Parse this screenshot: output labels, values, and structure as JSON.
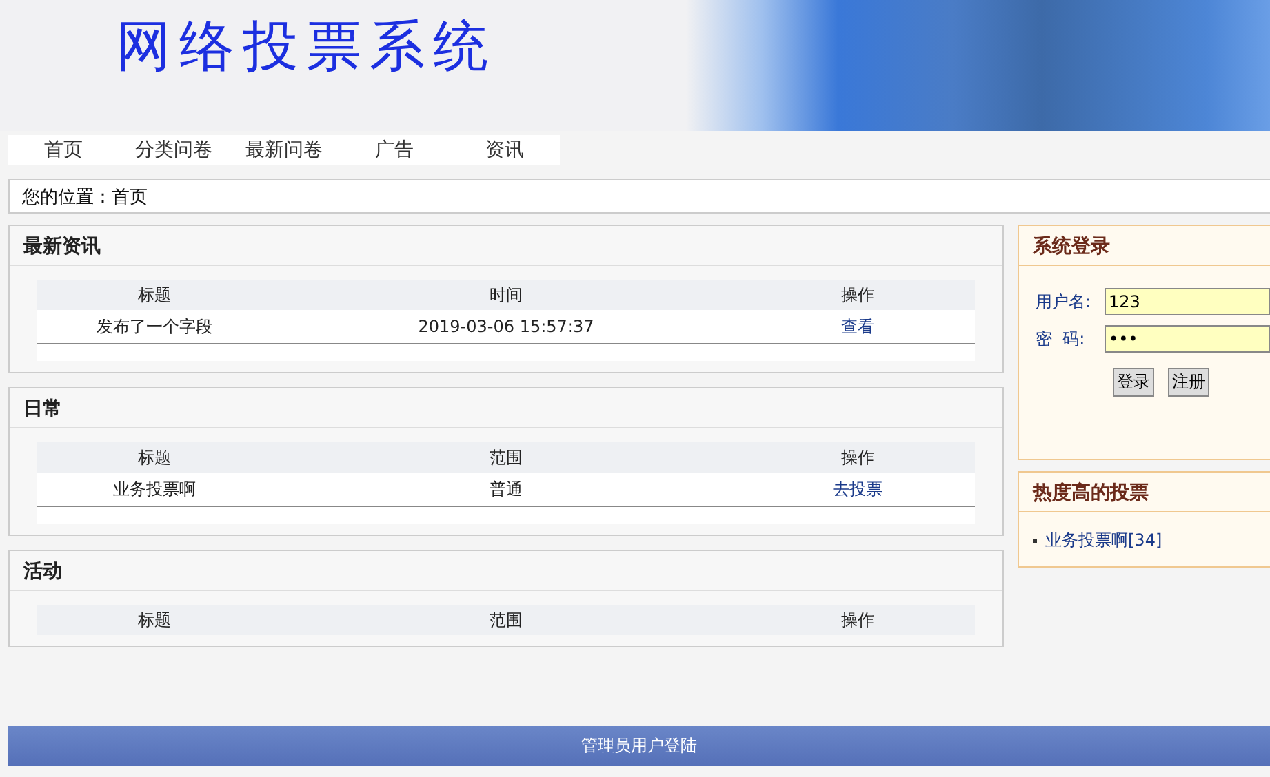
{
  "header": {
    "title": "网络投票系统"
  },
  "nav": [
    {
      "label": "首页"
    },
    {
      "label": "分类问卷"
    },
    {
      "label": "最新问卷"
    },
    {
      "label": "广告"
    },
    {
      "label": "资讯"
    }
  ],
  "breadcrumb": {
    "label": "您的位置：",
    "current": "首页"
  },
  "panels": [
    {
      "title": "最新资讯",
      "columns": [
        "标题",
        "时间",
        "操作"
      ],
      "rows": [
        [
          "发布了一个字段",
          "2019-03-06 15:57:37",
          "查看"
        ]
      ]
    },
    {
      "title": "日常",
      "columns": [
        "标题",
        "范围",
        "操作"
      ],
      "rows": [
        [
          "业务投票啊",
          "普通",
          "去投票"
        ]
      ]
    },
    {
      "title": "活动",
      "columns": [
        "标题",
        "范围",
        "操作"
      ]
    }
  ],
  "login": {
    "title": "系统登录",
    "username_label": "用户名:",
    "username": "123",
    "password_label": "密  码:",
    "password": "•••",
    "buttons": [
      "登录",
      "注册"
    ]
  },
  "hot": {
    "title": "热度高的投票",
    "items": [
      {
        "name": "业务投票啊",
        "count": "[34]"
      }
    ]
  },
  "footer": {
    "link": "管理员用户登陆"
  }
}
